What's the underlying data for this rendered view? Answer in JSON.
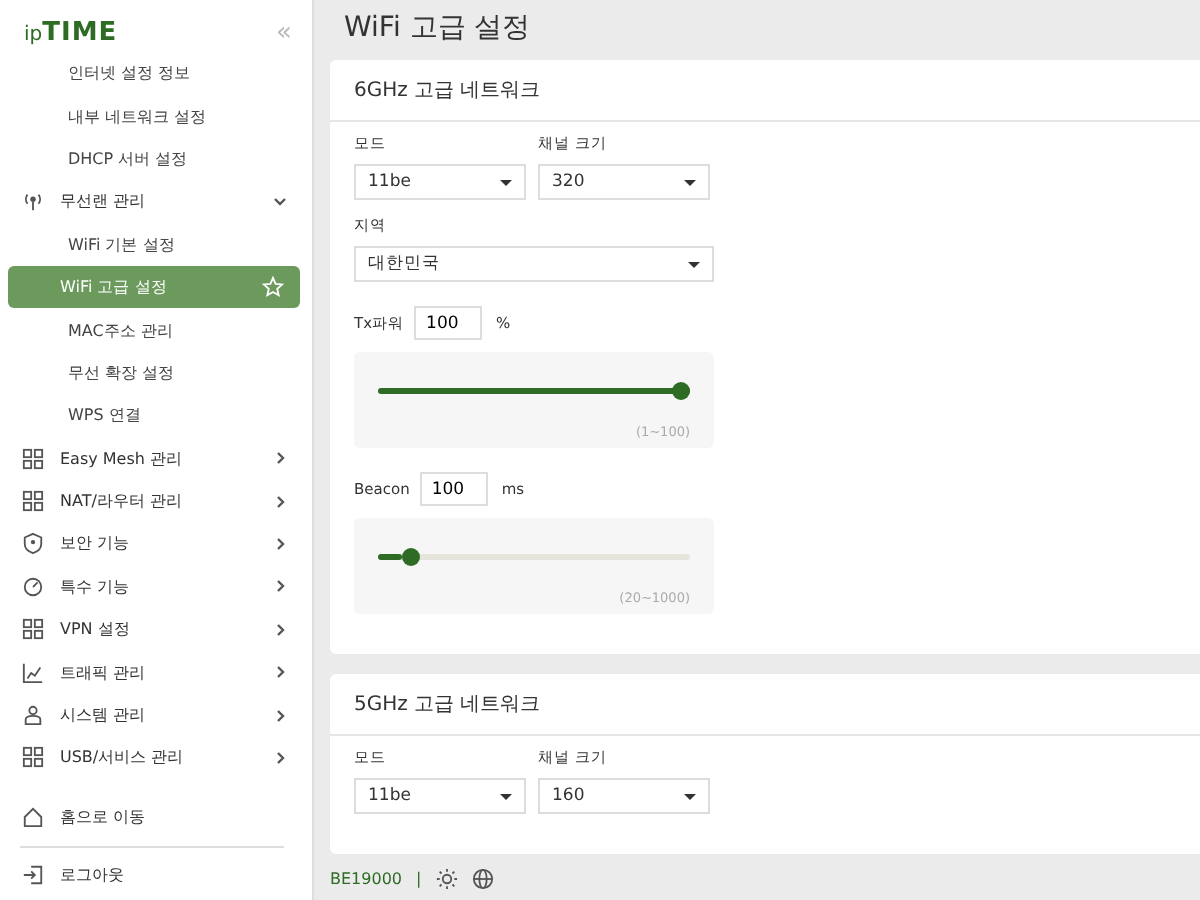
{
  "sidebar": {
    "logo": {
      "prefix": "ip",
      "name": "TIME"
    },
    "collapse": "«",
    "items": [
      {
        "kind": "sub",
        "label": "인터넷 설정 정보",
        "selected": false
      },
      {
        "kind": "sub",
        "label": "내부 네트워크 설정",
        "selected": false
      },
      {
        "kind": "sub",
        "label": "DHCP 서버 설정",
        "selected": false
      },
      {
        "kind": "group",
        "label": "무선랜 관리",
        "expanded": true
      },
      {
        "kind": "sub",
        "label": "WiFi 기본 설정",
        "selected": false
      },
      {
        "kind": "sub",
        "label": "WiFi 고급 설정",
        "selected": true
      },
      {
        "kind": "sub",
        "label": "MAC주소 관리",
        "selected": false
      },
      {
        "kind": "sub",
        "label": "무선 확장 설정",
        "selected": false
      },
      {
        "kind": "sub",
        "label": "WPS 연결",
        "selected": false
      },
      {
        "kind": "group",
        "label": "Easy Mesh 관리",
        "expanded": false
      },
      {
        "kind": "group",
        "label": "NAT/라우터 관리",
        "expanded": false
      },
      {
        "kind": "group",
        "label": "보안 기능",
        "expanded": false
      },
      {
        "kind": "group",
        "label": "특수 기능",
        "expanded": false
      },
      {
        "kind": "group",
        "label": "VPN 설정",
        "expanded": false
      },
      {
        "kind": "group",
        "label": "트래픽 관리",
        "expanded": false
      },
      {
        "kind": "group",
        "label": "시스템 관리",
        "expanded": false
      },
      {
        "kind": "group",
        "label": "USB/서비스 관리",
        "expanded": false
      }
    ],
    "home": "홈으로 이동",
    "logout": "로그아웃"
  },
  "page_title": "WiFi 고급 설정",
  "cards": [
    {
      "title": "6GHz 고급 네트워크",
      "mode": {
        "label": "모드",
        "value": "11be"
      },
      "channel": {
        "label": "채널 크기",
        "value": "320"
      },
      "region": {
        "label": "지역",
        "value": "대한민국"
      },
      "sliders": [
        {
          "label": "Tx파워",
          "value": "100",
          "unit": "%",
          "level": 1.0,
          "range": "(1~100)"
        },
        {
          "label": "Beacon",
          "value": "100",
          "unit": "ms",
          "level": 0.08,
          "range": "(20~1000)"
        }
      ]
    },
    {
      "title": "5GHz 고급 네트워크",
      "mode": {
        "label": "모드",
        "value": "11be"
      },
      "channel": {
        "label": "채널 크기",
        "value": "160"
      }
    }
  ],
  "footer": {
    "model": "BE19000",
    "separator": "|"
  }
}
